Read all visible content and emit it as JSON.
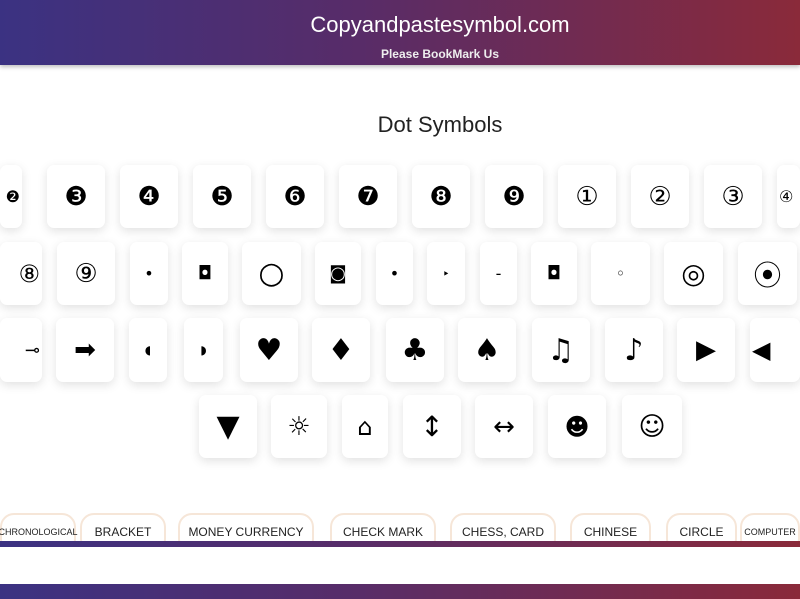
{
  "header": {
    "title": "Copyandpastesymbol.com",
    "subtitle": "Please BookMark Us"
  },
  "page_title": "Dot Symbols",
  "rows": [
    [
      "❷",
      "❸",
      "❹",
      "❺",
      "❻",
      "❼",
      "❽",
      "❾",
      "①",
      "②",
      "③",
      "④"
    ],
    [
      "⑧",
      "⑨",
      "•",
      "◘",
      "○",
      "◙",
      "•",
      "‣",
      "-",
      "◘",
      "◦",
      "◎",
      "⦿"
    ],
    [
      "⊸",
      "➡",
      "◖",
      "◗",
      "♥",
      "♦",
      "♣",
      "♠",
      "♫",
      "♪",
      "▶",
      "◀"
    ],
    [
      "▼",
      "☼",
      "⌂",
      "↕",
      "↔",
      "☻",
      "☺"
    ]
  ],
  "categories": [
    "CHRONOLOGICAL",
    "BRACKET",
    "MONEY CURRENCY",
    "CHECK MARK",
    "CHESS, CARD",
    "CHINESE",
    "CIRCLE",
    "COMPUTER"
  ],
  "colors": {
    "gradient_start": "#3b3282",
    "gradient_end": "#8a2a3a"
  }
}
